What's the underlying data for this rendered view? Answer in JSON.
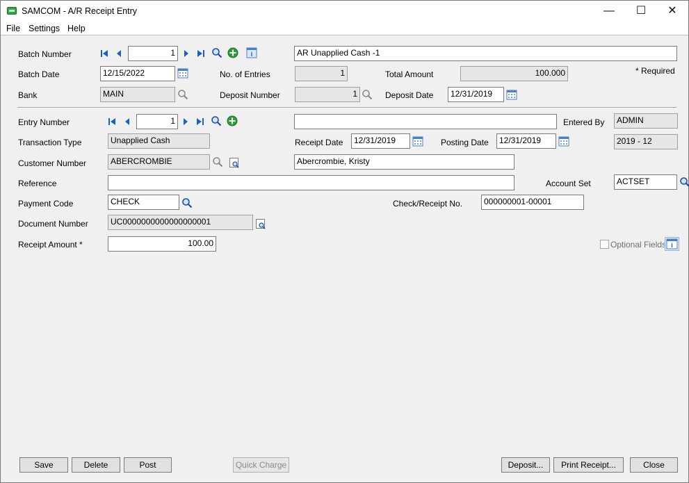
{
  "window": {
    "title": "SAMCOM - A/R Receipt Entry"
  },
  "menu": {
    "file": "File",
    "settings": "Settings",
    "help": "Help"
  },
  "batch": {
    "number_label": "Batch Number",
    "number": "1",
    "description": "AR Unapplied Cash -1",
    "date_label": "Batch Date",
    "date": "12/15/2022",
    "entries_label": "No. of Entries",
    "entries": "1",
    "total_label": "Total Amount",
    "total": "100.000",
    "required_note": "*  Required",
    "bank_label": "Bank",
    "bank": "MAIN",
    "deposit_number_label": "Deposit Number",
    "deposit_number": "1",
    "deposit_date_label": "Deposit Date",
    "deposit_date": "12/31/2019"
  },
  "entry": {
    "number_label": "Entry Number",
    "number": "1",
    "description": "",
    "entered_by_label": "Entered By",
    "entered_by": "ADMIN",
    "transaction_type_label": "Transaction Type",
    "transaction_type": "Unapplied Cash",
    "receipt_date_label": "Receipt Date",
    "receipt_date": "12/31/2019",
    "posting_date_label": "Posting Date",
    "posting_date": "12/31/2019",
    "period": "2019 - 12",
    "customer_number_label": "Customer Number",
    "customer_number": "ABERCROMBIE",
    "customer_name": "Abercrombie, Kristy",
    "reference_label": "Reference",
    "reference": "",
    "account_set_label": "Account Set",
    "account_set": "ACTSET",
    "payment_code_label": "Payment Code",
    "payment_code": "CHECK",
    "check_no_label": "Check/Receipt No.",
    "check_no": "000000001-00001",
    "document_number_label": "Document Number",
    "document_number": "UC0000000000000000001",
    "receipt_amount_label": "Receipt Amount *",
    "receipt_amount": "100.00",
    "optional_fields_label": "Optional Fields"
  },
  "buttons": {
    "save": "Save",
    "delete": "Delete",
    "post": "Post",
    "quick_charge": "Quick Charge",
    "deposit": "Deposit...",
    "print_receipt": "Print Receipt...",
    "close": "Close"
  },
  "colors": {
    "nav_blue": "#1f5fbf",
    "add_green": "#2e9d3a",
    "calendar_blue": "#4a7fc1"
  }
}
